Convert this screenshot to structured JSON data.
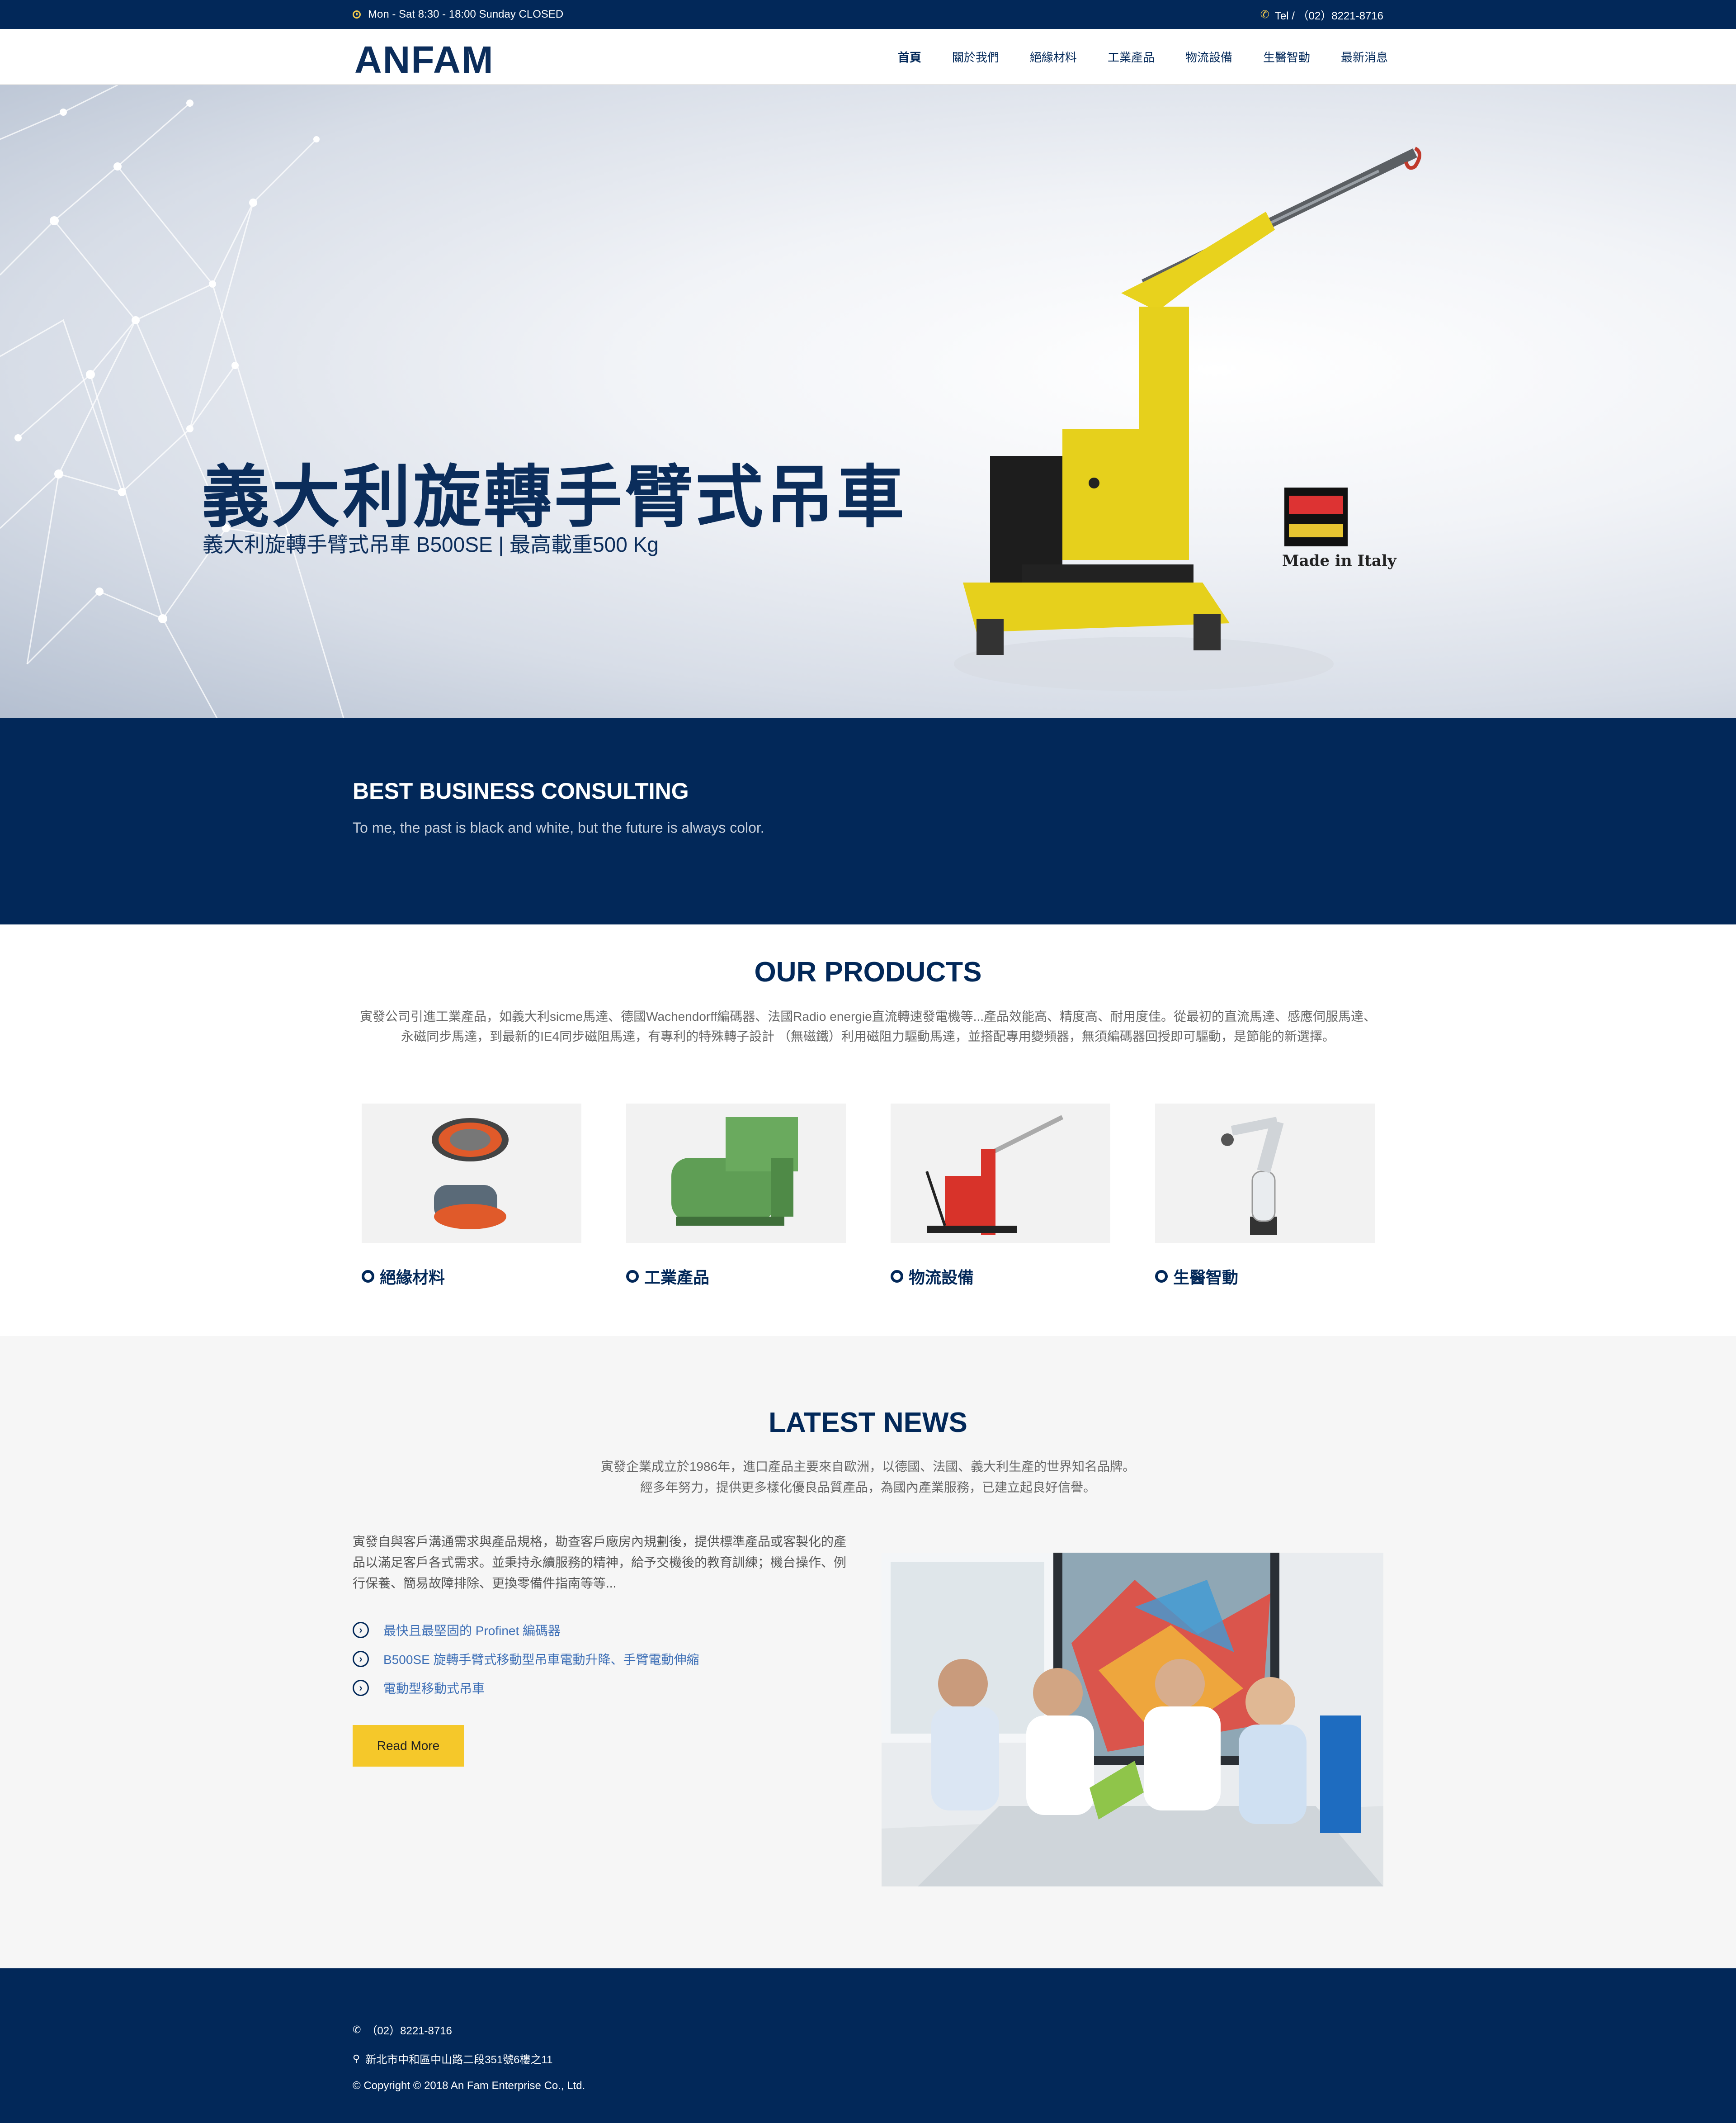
{
  "topbar": {
    "hours": "Mon - Sat 8:30 - 18:00 Sunday CLOSED",
    "tel": "Tel / （02）8221-8716",
    "icon_color": "#f2c94c"
  },
  "header": {
    "logo": "ANFAM",
    "nav": [
      {
        "label": "首頁",
        "active": true
      },
      {
        "label": "關於我們"
      },
      {
        "label": "絕緣材料"
      },
      {
        "label": "工業產品"
      },
      {
        "label": "物流設備"
      },
      {
        "label": "生醫智動"
      },
      {
        "label": "最新消息"
      }
    ]
  },
  "hero": {
    "title": "義大利旋轉手臂式吊車",
    "subtitle": "義大利旋轉手臂式吊車 B500SE | 最高載重500 Kg",
    "badge_text": "Made in Italy"
  },
  "consult": {
    "title": "BEST BUSINESS CONSULTING",
    "text": "To me, the past is black and white, but the future is always color."
  },
  "products": {
    "title": "OUR PRODUCTS",
    "desc_line1": "寅發公司引進工業產品，如義大利sicme馬達、德國Wachendorff編碼器、法國Radio energie直流轉速發電機等...產品效能高、精度高、耐用度佳。從最初的直流馬達、感應伺服馬達、",
    "desc_line2": "永磁同步馬達，到最新的IE4同步磁阻馬達，有專利的特殊轉子設計 （無磁鐵）利用磁阻力驅動馬達，並搭配專用變頻器，無須編碼器回授即可驅動，是節能的新選擇。",
    "items": [
      {
        "label": "絕緣材料"
      },
      {
        "label": "工業產品"
      },
      {
        "label": "物流設備"
      },
      {
        "label": "生醫智動"
      }
    ]
  },
  "news": {
    "title": "LATEST NEWS",
    "intro_line1": "寅發企業成立於1986年，進口產品主要來自歐洲，以德國、法國、義大利生產的世界知名品牌。",
    "intro_line2": "經多年努力，提供更多樣化優良品質產品，為國內產業服務，已建立起良好信譽。",
    "body": "寅發自與客戶溝通需求與產品規格，勘查客戶廠房內規劃後，提供標準產品或客製化的產品以滿足客戶各式需求。並秉持永續服務的精神，給予交機後的教育訓練；機台操作、例行保養、簡易故障排除、更換零備件指南等等...",
    "links": [
      "最快且最堅固的 Profinet 編碼器",
      "B500SE 旋轉手臂式移動型吊車電動升降、手臂電動伸縮",
      "電動型移動式吊車"
    ],
    "read_more": "Read More"
  },
  "footer": {
    "phone": "（02）8221-8716",
    "address": "新北市中和區中山路二段351號6樓之11",
    "copyright": "© Copyright © 2018 An Fam Enterprise Co., Ltd."
  },
  "colors": {
    "navy": "#022859",
    "accent_yellow": "#f5c82a",
    "link_blue": "#3d6fb6"
  }
}
